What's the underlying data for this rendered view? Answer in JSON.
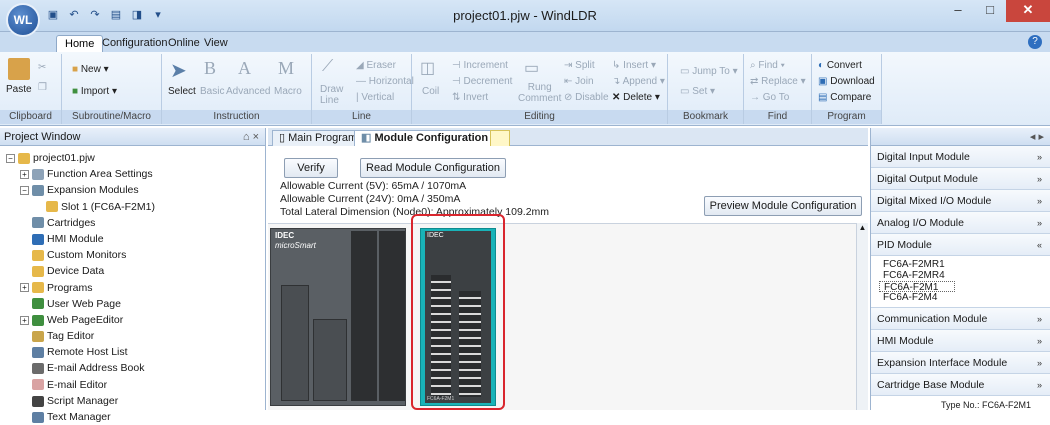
{
  "window": {
    "title": "project01.pjw - WindLDR",
    "app_button": "WL",
    "minimize": "–",
    "maximize": "□",
    "close": "✕"
  },
  "ribbon_tabs": [
    "Home",
    "Configuration",
    "Online",
    "View"
  ],
  "ribbon": {
    "clipboard": {
      "label": "Clipboard",
      "paste": "Paste"
    },
    "subroutine": {
      "label": "Subroutine/Macro",
      "new": "New",
      "import": "Import"
    },
    "instruction": {
      "label": "Instruction",
      "select": "Select",
      "basic": "Basic",
      "advanced": "Advanced",
      "macro": "Macro"
    },
    "line": {
      "label": "Line",
      "draw": "Draw",
      "draw2": "Line",
      "eraser": "Eraser",
      "horizontal": "Horizontal",
      "vertical": "Vertical"
    },
    "editing": {
      "label": "Editing",
      "coil": "Coil",
      "increment": "Increment",
      "decrement": "Decrement",
      "invert": "Invert",
      "rung": "Rung",
      "comment": "Comment",
      "split": "Split",
      "join": "Join",
      "disable": "Disable",
      "insert": "Insert",
      "append": "Append",
      "delete": "Delete"
    },
    "bookmark": {
      "label": "Bookmark",
      "jump": "Jump To",
      "set": "Set"
    },
    "find": {
      "label": "Find",
      "find": "Find",
      "replace": "Replace",
      "goto": "Go To"
    },
    "program": {
      "label": "Program",
      "convert": "Convert",
      "download": "Download",
      "compare": "Compare"
    }
  },
  "project_window": {
    "title": "Project Window",
    "pin": "⌂ ×",
    "nodes": [
      {
        "label": "project01.pjw",
        "level": 0,
        "expander": "−",
        "color": "#e6b84a"
      },
      {
        "label": "Function Area Settings",
        "level": 1,
        "expander": "+",
        "color": "#8ea3b8"
      },
      {
        "label": "Expansion Modules",
        "level": 1,
        "expander": "−",
        "color": "#6f8ea8"
      },
      {
        "label": "Slot 1 (FC6A-F2M1)",
        "level": 2,
        "expander": "",
        "color": "#e6b84a"
      },
      {
        "label": "Cartridges",
        "level": 1,
        "expander": "",
        "color": "#6f8ea8"
      },
      {
        "label": "HMI Module",
        "level": 1,
        "expander": "",
        "color": "#2e6db5"
      },
      {
        "label": "Custom Monitors",
        "level": 1,
        "expander": "",
        "color": "#e6b84a"
      },
      {
        "label": "Device Data",
        "level": 1,
        "expander": "",
        "color": "#e6b84a"
      },
      {
        "label": "Programs",
        "level": 1,
        "expander": "+",
        "color": "#e6b84a"
      },
      {
        "label": "User Web Page",
        "level": 1,
        "expander": "",
        "color": "#3f8f3f"
      },
      {
        "label": "Web PageEditor",
        "level": 1,
        "expander": "+",
        "color": "#3f8f3f"
      },
      {
        "label": "Tag Editor",
        "level": 1,
        "expander": "",
        "color": "#c9a54b"
      },
      {
        "label": "Remote Host List",
        "level": 1,
        "expander": "",
        "color": "#5e7fa3"
      },
      {
        "label": "E-mail Address Book",
        "level": 1,
        "expander": "",
        "color": "#6b6b6b"
      },
      {
        "label": "E-mail Editor",
        "level": 1,
        "expander": "",
        "color": "#d9a3a3"
      },
      {
        "label": "Script Manager",
        "level": 1,
        "expander": "",
        "color": "#444444"
      },
      {
        "label": "Text Manager",
        "level": 1,
        "expander": "",
        "color": "#5e7fa3"
      }
    ]
  },
  "doc_tabs": {
    "main_program": "Main Program",
    "module_config": "Module Configuration"
  },
  "module_config": {
    "verify": "Verify",
    "read": "Read Module Configuration",
    "preview": "Preview Module Configuration",
    "current5v": "Allowable Current (5V): 65mA / 1070mA",
    "current24v": "Allowable Current (24V): 0mA / 350mA",
    "dimension": "Total Lateral Dimension (Node0): Approximately 109.2mm",
    "brand": "IDEC",
    "brand2": "microSmart",
    "part": "FC6A-F2M1"
  },
  "modules_panel": {
    "categories": [
      {
        "label": "Digital Input Module",
        "chev": "»"
      },
      {
        "label": "Digital Output Module",
        "chev": "»"
      },
      {
        "label": "Digital Mixed I/O Module",
        "chev": "»"
      },
      {
        "label": "Analog I/O Module",
        "chev": "»"
      },
      {
        "label": "PID Module",
        "chev": "«"
      }
    ],
    "pid_items": [
      "FC6A-F2MR1",
      "FC6A-F2MR4",
      "FC6A-F2M1",
      "FC6A-F2M4"
    ],
    "selected_item": "FC6A-F2M1",
    "categories2": [
      {
        "label": "Communication Module",
        "chev": "»"
      },
      {
        "label": "HMI Module",
        "chev": "»"
      },
      {
        "label": "Expansion Interface Module",
        "chev": "»"
      },
      {
        "label": "Cartridge Base Module",
        "chev": "»"
      }
    ],
    "type_no": "Type No.: FC6A-F2M1"
  },
  "colors": {
    "accent": "#2e6db5",
    "highlight": "#d9262e",
    "module_teal": "#19b3b8"
  }
}
